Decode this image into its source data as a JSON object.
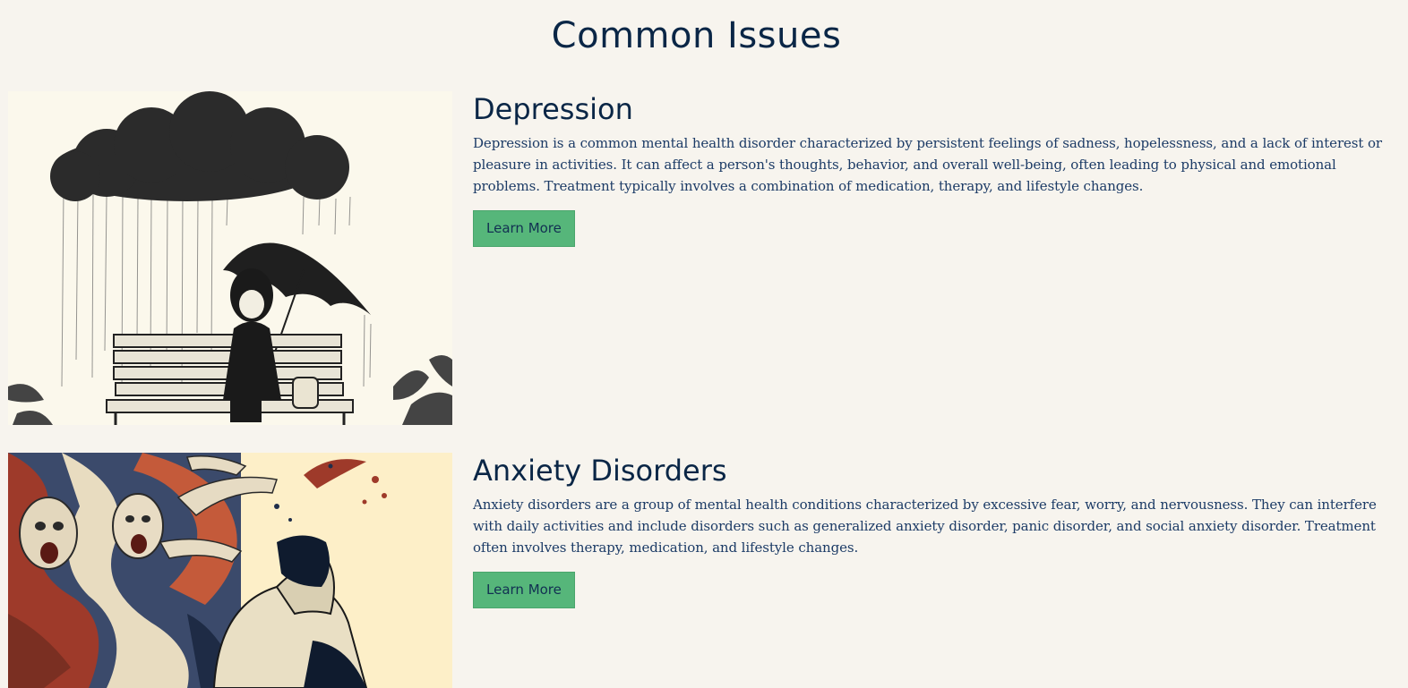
{
  "page": {
    "section_title": "Common Issues"
  },
  "issues": [
    {
      "title": "Depression",
      "description": "Depression is a common mental health disorder characterized by persistent feelings of sadness, hopelessness, and a lack of interest or pleasure in activities. It can affect a person's thoughts, behavior, and overall well-being, often leading to physical and emotional problems. Treatment typically involves a combination of medication, therapy, and lifestyle changes.",
      "button_label": "Learn More",
      "image": "depression-illustration"
    },
    {
      "title": "Anxiety Disorders",
      "description": "Anxiety disorders are a group of mental health conditions characterized by excessive fear, worry, and nervousness. They can interfere with daily activities and include disorders such as generalized anxiety disorder, panic disorder, and social anxiety disorder. Treatment often involves therapy, medication, and lifestyle changes.",
      "button_label": "Learn More",
      "image": "anxiety-illustration"
    }
  ],
  "colors": {
    "background": "#f7f4ee",
    "heading": "#0a2646",
    "body_text": "#1c3b66",
    "button": "#56b67a"
  }
}
